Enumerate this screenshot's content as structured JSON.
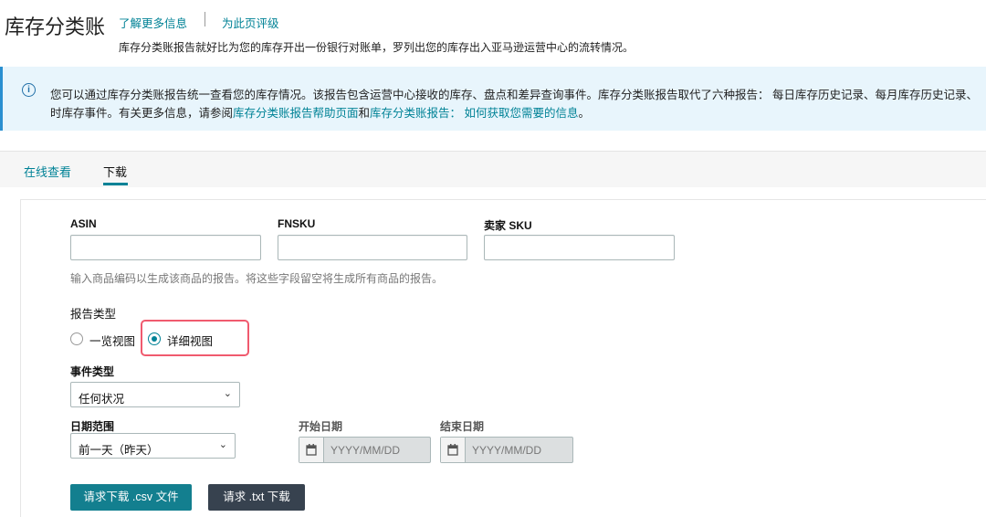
{
  "header": {
    "title": "库存分类账",
    "learn_more": "了解更多信息",
    "rate_page": "为此页评级",
    "subtitle": "库存分类账报告就好比为您的库存开出一份银行对账单，罗列出您的库存出入亚马逊运营中心的流转情况。"
  },
  "banner": {
    "line1": "您可以通过库存分类账报告统一查看您的库存情况。该报告包含运营中心接收的库存、盘点和差异查询事件。库存分类账报告取代了六种报告： 每日库存历史记录、每月库存历史记录、",
    "line2_prefix": "时库存事件。有关更多信息，请参阅",
    "link1": "库存分类账报告帮助页面",
    "and": "和",
    "link2": "库存分类账报告： 如何获取您需要的信息",
    "end": "。"
  },
  "tabs": [
    {
      "label": "在线查看"
    },
    {
      "label": "下载"
    }
  ],
  "form": {
    "asin_label": "ASIN",
    "asin_value": "",
    "fnsku_label": "FNSKU",
    "fnsku_value": "",
    "sku_label": "卖家 SKU",
    "sku_value": "",
    "hint": "输入商品编码以生成该商品的报告。将这些字段留空将生成所有商品的报告。",
    "report_type_label": "报告类型",
    "report_types": [
      {
        "label": "一览视图",
        "selected": false
      },
      {
        "label": "详细视图",
        "selected": true
      }
    ],
    "event_type_label": "事件类型",
    "event_type_value": "任何状况",
    "date_range_label": "日期范围",
    "date_range_value": "前一天（昨天）",
    "start_date_label": "开始日期",
    "start_date_placeholder": "YYYY/MM/DD",
    "end_date_label": "结束日期",
    "end_date_placeholder": "YYYY/MM/DD",
    "csv_button": "请求下载 .csv 文件",
    "txt_button": "请求 .txt 下载"
  },
  "colors": {
    "accent": "#008296",
    "highlight": "#f05a6e",
    "dark_button": "#37424f"
  }
}
